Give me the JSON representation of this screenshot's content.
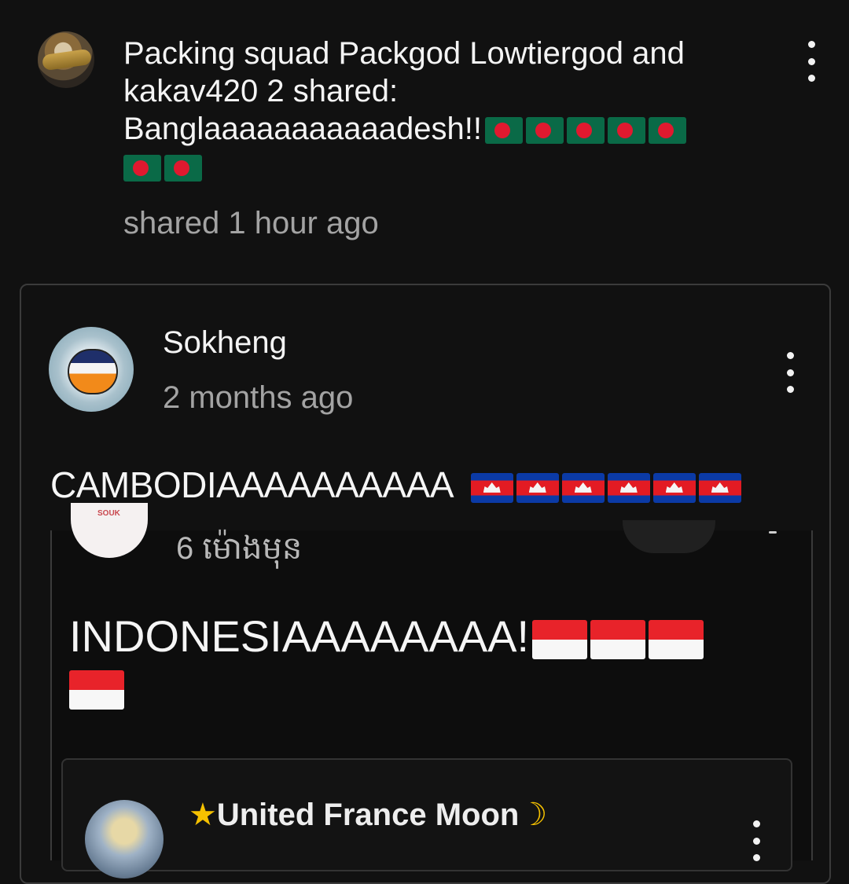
{
  "post": {
    "author_line": "Packing squad Packgod Lowtiergod and kakav420 2 shared:",
    "message": "Banglaaaaaaaaaaadesh!!",
    "flag_count": 7,
    "time": "shared 1 hour ago",
    "menu_icon": "more-vertical-icon"
  },
  "quoted": {
    "author": "Sokheng",
    "time": "2 months ago",
    "message": "CAMBODIAAAAAAAAAA",
    "flag_count": 6,
    "embedded": {
      "time_khmer": "6 ម៉ោងមុន",
      "message": "INDONESIAAAAAAAA!",
      "flag_count": 4,
      "nested": {
        "author": "United France Moon"
      }
    }
  },
  "colors": {
    "background": "#111111",
    "text_primary": "#f2f2f2",
    "text_secondary": "#a3a3a3",
    "card_border": "#3b3b3b"
  }
}
